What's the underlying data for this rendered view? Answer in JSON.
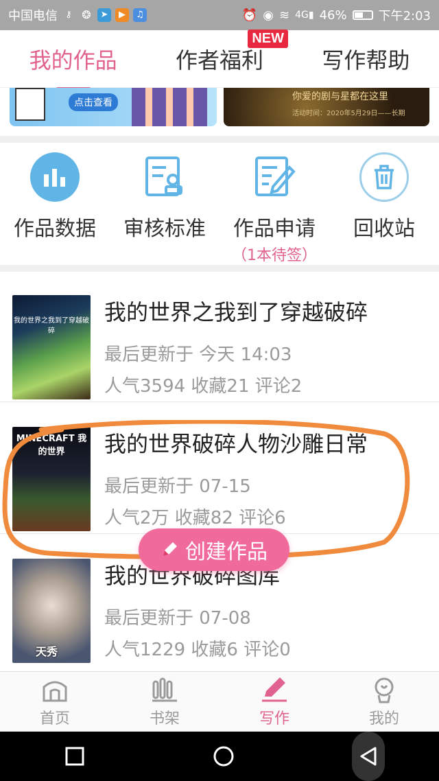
{
  "status_bar": {
    "carrier": "中国电信",
    "battery": "46%",
    "time": "下午2:03"
  },
  "header": {
    "tabs": [
      {
        "label": "我的作品",
        "active": true
      },
      {
        "label": "作者福利",
        "badge": "NEW"
      },
      {
        "label": "写作帮助"
      }
    ]
  },
  "banners": {
    "left": {
      "button": "点击查看"
    },
    "right": {
      "text": "你爱的剧与星都在这里",
      "sub": "活动时间：2020年5月29日——长期"
    }
  },
  "tools": [
    {
      "label": "作品数据",
      "icon": "bar-chart-icon"
    },
    {
      "label": "审核标准",
      "icon": "review-stamp-icon"
    },
    {
      "label": "作品申请",
      "icon": "edit-doc-icon",
      "sub": "（1本待签）"
    },
    {
      "label": "回收站",
      "icon": "trash-icon"
    }
  ],
  "works": [
    {
      "title": "我的世界之我到了穿越破碎",
      "updated": "最后更新于 今天 14:03",
      "stats": "人气3594 收藏21 评论2",
      "cover_text": "我的世界之我到了穿越破碎"
    },
    {
      "title": "我的世界破碎人物沙雕日常",
      "updated": "最后更新于 07-15",
      "stats": "人气2万 收藏82 评论6",
      "cover_text": "MINECRAFT 我的世界"
    },
    {
      "title": "我的世界破碎图库",
      "updated": "最后更新于 07-08",
      "stats": "人气1229 收藏6 评论0",
      "cover_text": "天秀"
    }
  ],
  "fab": {
    "label": "创建作品"
  },
  "bottom_nav": [
    {
      "label": "首页",
      "icon": "home-icon"
    },
    {
      "label": "书架",
      "icon": "bookshelf-icon"
    },
    {
      "label": "写作",
      "icon": "pen-icon",
      "active": true
    },
    {
      "label": "我的",
      "icon": "profile-icon"
    }
  ],
  "colors": {
    "accent": "#e2628f",
    "fab": "#f06b9b",
    "highlight": "#f08a3c",
    "icon_blue": "#61b5e6"
  }
}
